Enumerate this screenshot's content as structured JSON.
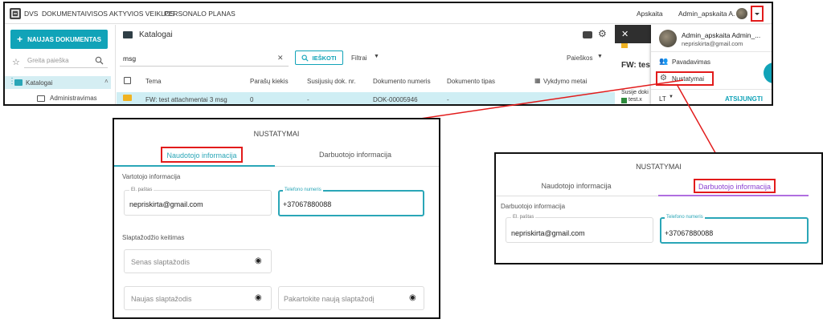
{
  "app": {
    "logo_text": "DVS",
    "nav": [
      "DOKUMENTAI",
      "VISOS AKTYVIOS VEIKLOS",
      "PERSONALO PLANAS"
    ],
    "account_area": "Apskaita",
    "user_short": "Admin_apskaita A.",
    "new_document_button": "NAUJAS DOKUMENTAS",
    "quick_search_placeholder": "Greita paieška",
    "tree": {
      "root": "Katalogai",
      "child": "Administravimas"
    },
    "header_title": "Katalogai",
    "search_value": "msg",
    "search_button": "IEŠKOTI",
    "filters_label": "Filtrai",
    "search_scope": "Paieškos",
    "columns": [
      "Tema",
      "Parašų kiekis",
      "Susijusių dok. nr.",
      "Dokumento numeris",
      "Dokumento tipas",
      "Vykdymo metai"
    ],
    "row": {
      "subject": "FW: test attachmentai 3 msg",
      "signatures": "0",
      "related": "-",
      "number": "DOK-00005946",
      "type": "-"
    },
    "preview": {
      "title": "FW: tes",
      "related_label": "Susije doki",
      "file": "test.x"
    },
    "user_menu": {
      "name": "Admin_apskaita Admin_...",
      "email": "nepriskirta@gmail.com",
      "items": [
        "Pavadavimas",
        "Nustatymai"
      ],
      "language": "LT",
      "logout": "ATSIJUNGTI"
    },
    "accent": "#11a3b8",
    "highlight_color": "#e21b1b"
  },
  "dialog_user": {
    "title": "NUSTATYMAI",
    "tabs": [
      "Naudotojo informacija",
      "Darbuotojo informacija"
    ],
    "section_user": "Vartotojo informacija",
    "email_label": "El. paštas",
    "email_value": "nepriskirta@gmail.com",
    "phone_label": "Telefono numeris",
    "phone_value": "+37067880088",
    "section_password": "Slaptažodžio keitimas",
    "old_password": "Senas slaptažodis",
    "new_password": "Naujas slaptažodis",
    "repeat_password": "Pakartokite naują slaptažodį"
  },
  "dialog_employee": {
    "title": "NUSTATYMAI",
    "tabs": [
      "Naudotojo informacija",
      "Darbuotojo informacija"
    ],
    "section": "Darbuotojo informacija",
    "email_label": "El. paštas",
    "email_value": "nepriskirta@gmail.com",
    "phone_label": "Telefono numeris",
    "phone_value": "+37067880088"
  }
}
